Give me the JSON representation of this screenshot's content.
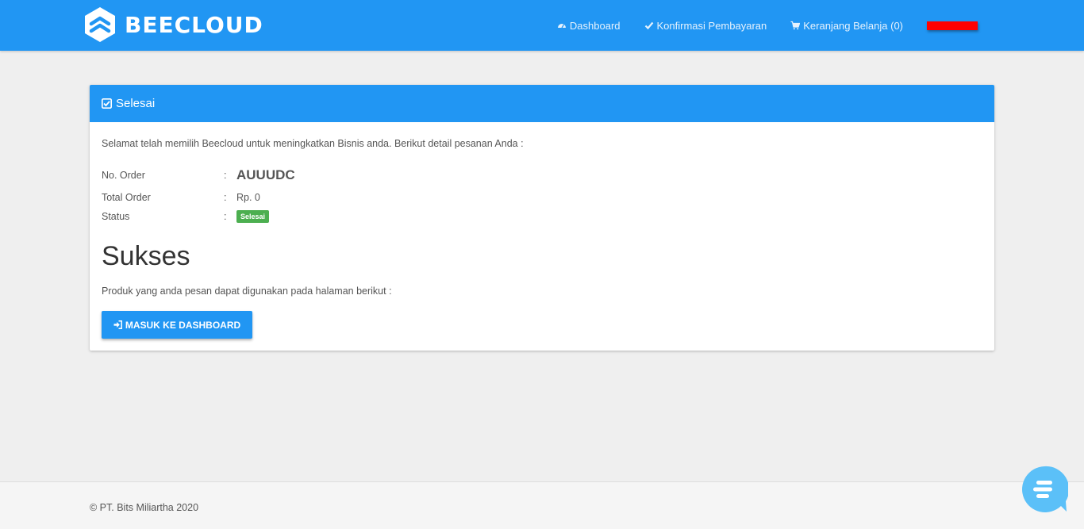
{
  "navbar": {
    "brand": "BEECLOUD",
    "links": [
      {
        "label": "Dashboard",
        "icon": "dashboard-icon"
      },
      {
        "label": "Konfirmasi Pembayaran",
        "icon": "check-icon"
      },
      {
        "label": "Keranjang Belanja (0)",
        "icon": "shopping-cart-icon"
      }
    ],
    "user_redacted": true
  },
  "panel": {
    "heading": "Selesai",
    "heading_icon": "check-square-icon",
    "intro": "Selamat telah memilih Beecloud untuk meningkatkan Bisnis anda. Berikut detail pesanan Anda :",
    "order": {
      "no_label": "No. Order",
      "no_value": "AUUUDC",
      "total_label": "Total Order",
      "total_value": "Rp. 0",
      "status_label": "Status",
      "status_value": "Selesai",
      "separator": ":"
    },
    "success_title": "Sukses",
    "product_text": "Produk yang anda pesan dapat digunakan pada halaman berikut :",
    "button_label": "MASUK KE DASHBOARD",
    "button_icon": "sign-in-icon"
  },
  "footer": {
    "text": "© PT. Bits Miliartha 2020"
  },
  "chat_widget": {
    "icon": "chat-bubble-icon"
  },
  "colors": {
    "primary": "#2196f3",
    "background": "#efefef",
    "success": "#4caf50",
    "redaction": "#ff0000",
    "chat": "#5bc0f8"
  }
}
